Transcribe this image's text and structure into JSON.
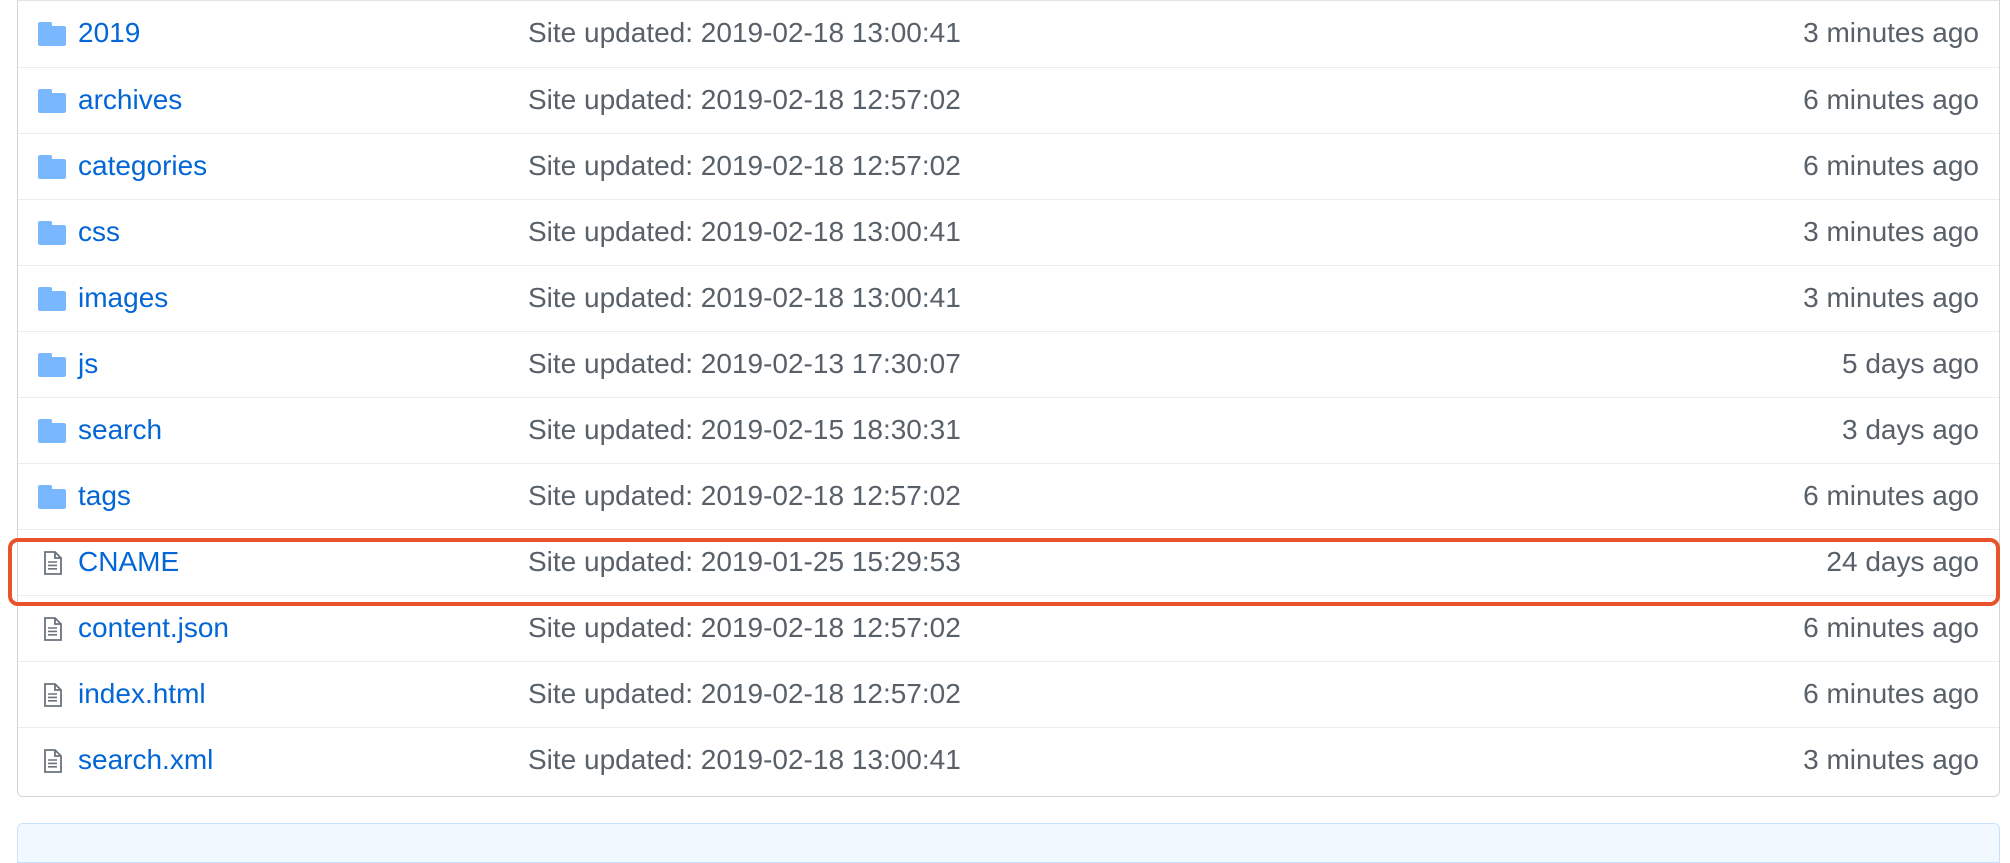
{
  "files": [
    {
      "type": "dir",
      "icon": "folder-icon",
      "name": "2019",
      "message": "Site updated: 2019-02-18 13:00:41",
      "age": "3 minutes ago"
    },
    {
      "type": "dir",
      "icon": "folder-icon",
      "name": "archives",
      "message": "Site updated: 2019-02-18 12:57:02",
      "age": "6 minutes ago"
    },
    {
      "type": "dir",
      "icon": "folder-icon",
      "name": "categories",
      "message": "Site updated: 2019-02-18 12:57:02",
      "age": "6 minutes ago"
    },
    {
      "type": "dir",
      "icon": "folder-icon",
      "name": "css",
      "message": "Site updated: 2019-02-18 13:00:41",
      "age": "3 minutes ago"
    },
    {
      "type": "dir",
      "icon": "folder-icon",
      "name": "images",
      "message": "Site updated: 2019-02-18 13:00:41",
      "age": "3 minutes ago"
    },
    {
      "type": "dir",
      "icon": "folder-icon",
      "name": "js",
      "message": "Site updated: 2019-02-13 17:30:07",
      "age": "5 days ago"
    },
    {
      "type": "dir",
      "icon": "folder-icon",
      "name": "search",
      "message": "Site updated: 2019-02-15 18:30:31",
      "age": "3 days ago"
    },
    {
      "type": "dir",
      "icon": "folder-icon",
      "name": "tags",
      "message": "Site updated: 2019-02-18 12:57:02",
      "age": "6 minutes ago"
    },
    {
      "type": "file",
      "icon": "file-icon",
      "name": "CNAME",
      "message": "Site updated: 2019-01-25 15:29:53",
      "age": "24 days ago",
      "highlighted": true
    },
    {
      "type": "file",
      "icon": "file-icon",
      "name": "content.json",
      "message": "Site updated: 2019-02-18 12:57:02",
      "age": "6 minutes ago"
    },
    {
      "type": "file",
      "icon": "file-icon",
      "name": "index.html",
      "message": "Site updated: 2019-02-18 12:57:02",
      "age": "6 minutes ago"
    },
    {
      "type": "file",
      "icon": "file-icon",
      "name": "search.xml",
      "message": "Site updated: 2019-02-18 13:00:41",
      "age": "3 minutes ago"
    }
  ],
  "colors": {
    "link": "#0366d6",
    "muted": "#586069",
    "folder_icon": "#79b8ff",
    "file_icon": "#6a737d",
    "highlight_border": "#e8532b"
  }
}
